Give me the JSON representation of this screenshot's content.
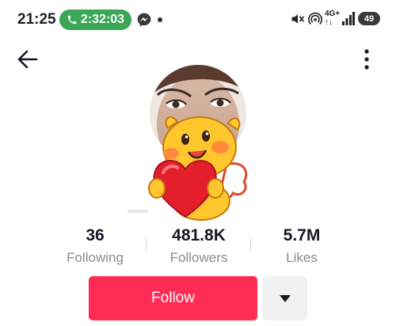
{
  "status_bar": {
    "time": "21:25",
    "call_duration": "2:32:03",
    "network_label_top": "4G+",
    "network_label_bottom": "↑↓",
    "battery": "49"
  },
  "profile": {
    "stats": [
      {
        "value": "36",
        "label": "Following"
      },
      {
        "value": "481.8K",
        "label": "Followers"
      },
      {
        "value": "5.7M",
        "label": "Likes"
      }
    ]
  },
  "actions": {
    "follow_label": "Follow"
  },
  "icons": {
    "back": "arrow-left-icon",
    "more": "more-vertical-icon",
    "dropdown": "caret-down-icon",
    "call": "phone-icon",
    "messenger": "messenger-icon",
    "mute": "mute-icon",
    "hotspot": "hotspot-icon",
    "signal": "signal-icon"
  },
  "colors": {
    "follow_button": "#fe2c55",
    "call_pill": "#3aa757",
    "secondary_button": "#f1f1f2"
  }
}
